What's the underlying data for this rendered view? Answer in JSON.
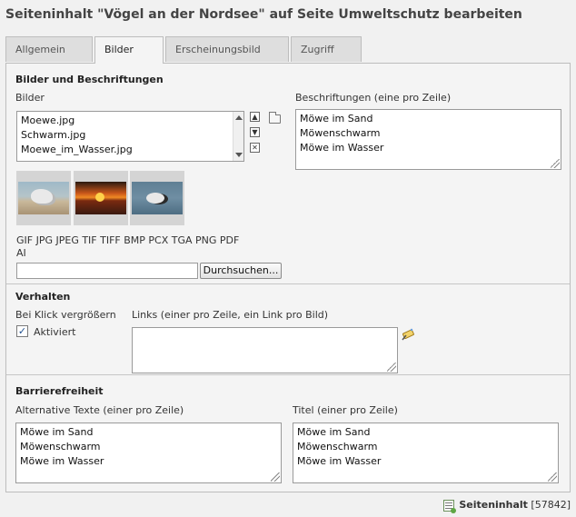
{
  "page": {
    "title": "Seiteninhalt \"Vögel an der Nordsee\" auf Seite Umweltschutz bearbeiten"
  },
  "tabs": [
    {
      "label": "Allgemein",
      "active": false
    },
    {
      "label": "Bilder",
      "active": true
    },
    {
      "label": "Erscheinungsbild",
      "active": false
    },
    {
      "label": "Zugriff",
      "active": false
    }
  ],
  "images_section": {
    "title": "Bilder und Beschriftungen",
    "images_label": "Bilder",
    "files": [
      "Moewe.jpg",
      "Schwarm.jpg",
      "Moewe_im_Wasser.jpg"
    ],
    "captions_label": "Beschriftungen (eine pro Zeile)",
    "captions": [
      "Möwe im Sand",
      "Möwenschwarm",
      "Möwe im Wasser"
    ],
    "allowed_types_line1": "GIF JPG JPEG TIF TIFF BMP PCX TGA PNG PDF",
    "allowed_types_line2": "AI",
    "browse_label": "Durchsuchen...",
    "file_value": ""
  },
  "behavior_section": {
    "title": "Verhalten",
    "zoom_label": "Bei Klick vergrößern",
    "activated_label": "Aktiviert",
    "activated_checked": true,
    "links_label": "Links (einer pro Zeile, ein Link pro Bild)",
    "links_value": ""
  },
  "accessibility_section": {
    "title": "Barrierefreiheit",
    "alt_label": "Alternative Texte (einer pro Zeile)",
    "alt_texts": [
      "Möwe im Sand",
      "Möwenschwarm",
      "Möwe im Wasser"
    ],
    "title_label": "Titel (einer pro Zeile)",
    "titles": [
      "Möwe im Sand",
      "Möwenschwarm",
      "Möwe im Wasser"
    ]
  },
  "footer": {
    "record_type": "Seiteninhalt",
    "record_id": "[57842]"
  },
  "icons": {
    "move_up": "arrow-up-icon",
    "move_down": "arrow-down-icon",
    "remove": "remove-icon",
    "browse_folder": "folder-icon",
    "link_wizard": "link-wizard-icon",
    "record": "content-element-icon",
    "checkmark": "✓"
  }
}
